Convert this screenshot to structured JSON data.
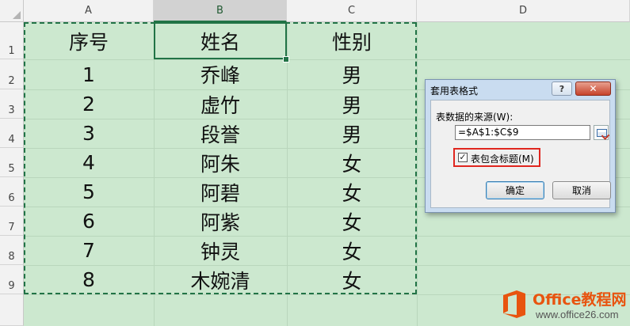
{
  "columns": [
    "A",
    "B",
    "C",
    "D"
  ],
  "rows": [
    "1",
    "2",
    "3",
    "4",
    "5",
    "6",
    "7",
    "8",
    "9"
  ],
  "header": {
    "seq": "序号",
    "name": "姓名",
    "gender": "性别"
  },
  "data": [
    {
      "seq": "1",
      "name": "乔峰",
      "gender": "男"
    },
    {
      "seq": "2",
      "name": "虚竹",
      "gender": "男"
    },
    {
      "seq": "3",
      "name": "段誉",
      "gender": "男"
    },
    {
      "seq": "4",
      "name": "阿朱",
      "gender": "女"
    },
    {
      "seq": "5",
      "name": "阿碧",
      "gender": "女"
    },
    {
      "seq": "6",
      "name": "阿紫",
      "gender": "女"
    },
    {
      "seq": "7",
      "name": "钟灵",
      "gender": "女"
    },
    {
      "seq": "8",
      "name": "木婉清",
      "gender": "女"
    }
  ],
  "dialog": {
    "title": "套用表格式",
    "help_glyph": "?",
    "close_glyph": "✕",
    "source_label": "表数据的来源(W):",
    "source_value": "=$A$1:$C$9",
    "checkbox_checked": true,
    "checkbox_glyph": "✓",
    "checkbox_label": "表包含标题(M)",
    "ok_label": "确定",
    "cancel_label": "取消"
  },
  "watermark": {
    "title": "Office教程网",
    "url": "www.office26.com"
  },
  "colors": {
    "selection": "#217346",
    "highlight": "#e0261f",
    "watermark": "#e8540f",
    "sheet_bg": "#cce8cf"
  }
}
